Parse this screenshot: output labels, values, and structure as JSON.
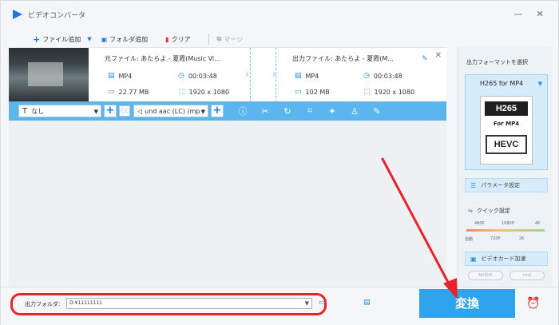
{
  "window": {
    "title": "ビデオコンバータ",
    "minimize": "—",
    "close": "✕"
  },
  "toolbar": {
    "add_file": "ファイル追加",
    "add_folder": "フォルダ追加",
    "clear": "クリア",
    "merge": "マージ"
  },
  "file": {
    "source_name": "元ファイル: あたらよ - 夏霞(Music Vi...",
    "output_name": "出力ファイル: あたらよ - 夏霞(M...",
    "source": {
      "format": "MP4",
      "duration": "00:03:48",
      "size": "22.77 MB",
      "resolution": "1920 x 1080"
    },
    "output": {
      "format": "MP4",
      "duration": "00:03:48",
      "size": "102 MB",
      "resolution": "1920 x 1080"
    }
  },
  "editbar": {
    "subtitle": "なし",
    "cc": "CC",
    "audio": "und aac (LC) (mp",
    "tools": [
      "info-icon",
      "scissors-icon",
      "rotate-icon",
      "crop-icon",
      "effects-icon",
      "watermark-icon",
      "edit-icon"
    ]
  },
  "right_panel": {
    "format_label": "出力フォーマットを選択",
    "format_title": "H265 for MP4",
    "card_top": "H265",
    "card_mid": "For MP4",
    "card_bottom": "HEVC",
    "param_button": "パラメータ設定",
    "quick_label": "クイック設定",
    "quality_top": [
      "480P",
      "1080P",
      "4K"
    ],
    "quality_bottom": [
      "自動",
      "720P",
      "2K"
    ],
    "gpu_button": "ビデオカード加速",
    "gpu_brands": [
      "NVIDIA",
      "intel"
    ]
  },
  "bottom": {
    "output_label": "出力フォルダ:",
    "output_path": "D:¥11111111",
    "convert": "変換"
  },
  "colors": {
    "accent": "#2fa4ec",
    "highlight": "#e8232b",
    "editbar": "#5bb6ee"
  }
}
